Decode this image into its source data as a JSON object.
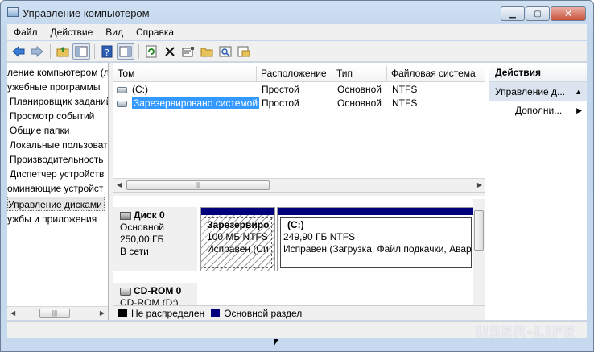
{
  "window": {
    "title": "Управление компьютером"
  },
  "colors": {
    "accent_bar": "#00007c",
    "selection": "#3399ff",
    "unallocated_swatch": "#000000",
    "primary_swatch": "#00007c"
  },
  "menu": [
    "Файл",
    "Действие",
    "Вид",
    "Справка"
  ],
  "toolbar_icons": [
    "back-arrow-icon",
    "forward-arrow-icon",
    "up-folder-icon",
    "show-hide-tree-icon",
    "help-icon",
    "show-hide-action-pane-icon",
    "refresh-icon",
    "delete-icon",
    "properties-icon",
    "open-folder-icon",
    "search-icon",
    "export-icon"
  ],
  "tree": {
    "items": [
      "ление компьютером (л",
      "ужебные программы",
      "Планировщик заданий",
      "Просмотр событий",
      "Общие папки",
      "Локальные пользовате",
      "Производительность",
      "Диспетчер устройств",
      "оминающие устройст",
      "Управление дисками",
      "ужбы и приложения"
    ],
    "selected_index": 9
  },
  "volume_list": {
    "columns": [
      "Том",
      "Расположение",
      "Тип",
      "Файловая система"
    ],
    "rows": [
      {
        "name": "(C:)",
        "layout": "Простой",
        "type": "Основной",
        "fs": "NTFS"
      },
      {
        "name": "Зарезервировано системой",
        "layout": "Простой",
        "type": "Основной",
        "fs": "NTFS"
      }
    ]
  },
  "disks": [
    {
      "label": "Диск 0",
      "type": "Основной",
      "size": "250,00 ГБ",
      "status": "В сети",
      "partitions": [
        {
          "name": "Зарезервиро",
          "size": "100 МБ NTFS",
          "status": "Исправен (Си"
        },
        {
          "name": "(C:)",
          "size": "249,90 ГБ NTFS",
          "status": "Исправен (Загрузка, Файл подкачки, Авар"
        }
      ]
    },
    {
      "label": "CD-ROM 0",
      "type": "CD-ROM (D:)"
    }
  ],
  "legend": [
    {
      "label": "Не распределен"
    },
    {
      "label": "Основной раздел"
    }
  ],
  "actions": {
    "header": "Действия",
    "section": "Управление д...",
    "more": "Дополни..."
  },
  "watermark": "USER-LIFE"
}
